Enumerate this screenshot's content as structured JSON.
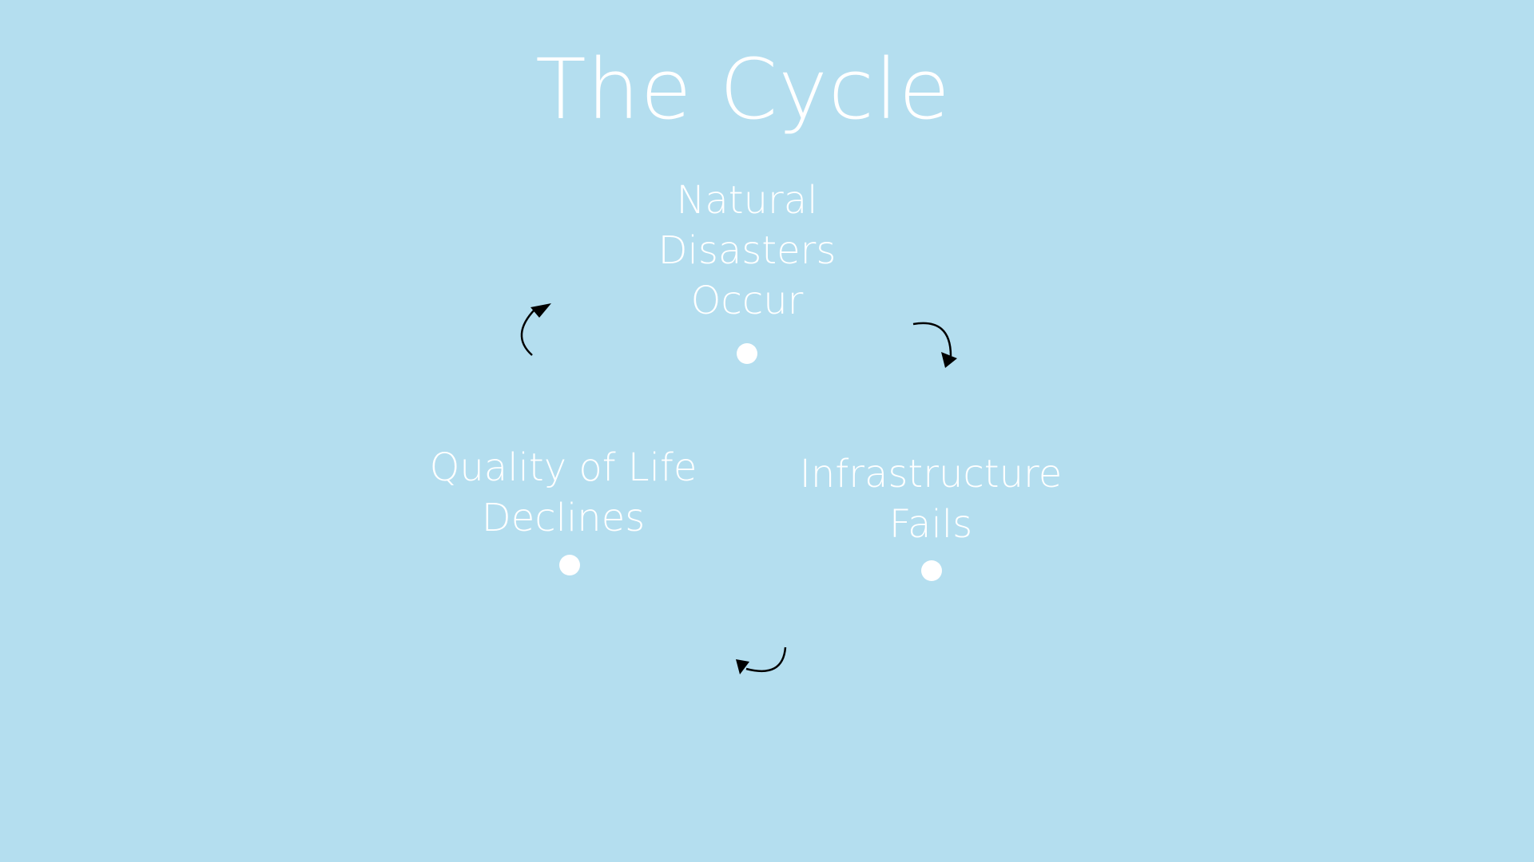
{
  "slide": {
    "title": "The Cycle",
    "background_color": "#b4deef",
    "text_color": "#ffffff",
    "arrow_color": "#000000"
  },
  "cycle": {
    "nodes": [
      {
        "lines": [
          "Natural",
          "Disasters",
          "Occur"
        ]
      },
      {
        "lines": [
          "Infrastructure",
          "Fails"
        ]
      },
      {
        "lines": [
          "Quality of Life",
          "Declines"
        ]
      }
    ],
    "arrows": [
      {
        "name": "curved-arrow-icon",
        "from": "Natural Disasters Occur",
        "to": "Infrastructure Fails"
      },
      {
        "name": "curved-arrow-icon",
        "from": "Infrastructure Fails",
        "to": "Quality of Life Declines"
      },
      {
        "name": "curved-arrow-icon",
        "from": "Quality of Life Declines",
        "to": "Natural Disasters Occur"
      }
    ]
  }
}
